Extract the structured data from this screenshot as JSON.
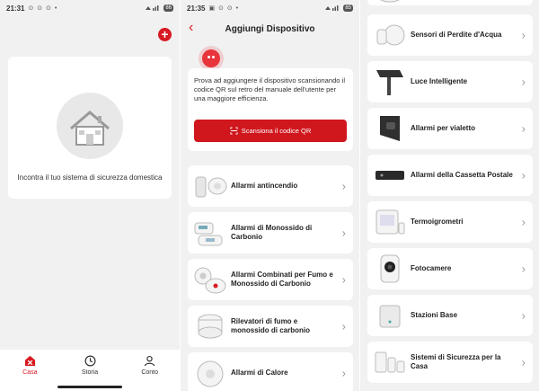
{
  "status1": {
    "time": "21:31",
    "dots": "⊙ ⊙ ⊙ •",
    "battery": "86"
  },
  "status2": {
    "time": "21:35",
    "dots": "▣ ⊙ ⊙ •",
    "battery": "85"
  },
  "home": {
    "add_icon": "plus-icon",
    "empty_text": "Incontra il tuo sistema di sicurezza domestica",
    "nav": [
      {
        "label": "Casa",
        "icon": "home-alert-icon"
      },
      {
        "label": "Storia",
        "icon": "clock-icon"
      },
      {
        "label": "Conto",
        "icon": "user-icon"
      }
    ]
  },
  "add_device": {
    "title": "Aggiungi Dispositivo",
    "qr_text": "Prova ad aggiungere il dispositivo scansionando il codice QR sul retro del manuale dell'utente per una maggiore efficienza.",
    "qr_button": "Scansiona il codice QR",
    "devices": [
      "Allarmi antincendio",
      "Allarmi di Monossido di Carbonio",
      "Allarmi Combinati per Fumo e Monossido di Carbonio",
      "Rilevatori di fumo e monossido di carbonio",
      "Allarmi di Calore"
    ]
  },
  "device_list_2": [
    "Sensori di Perdite d'Acqua",
    "Luce Intelligente",
    "Allarmi per vialetto",
    "Allarmi della Cassetta Postale",
    "Termoigrometri",
    "Fotocamere",
    "Stazioni Base",
    "Sistemi di Sicurezza per la Casa"
  ],
  "colors": {
    "accent": "#d71a21",
    "background": "#f1f1f1",
    "card": "#ffffff"
  }
}
